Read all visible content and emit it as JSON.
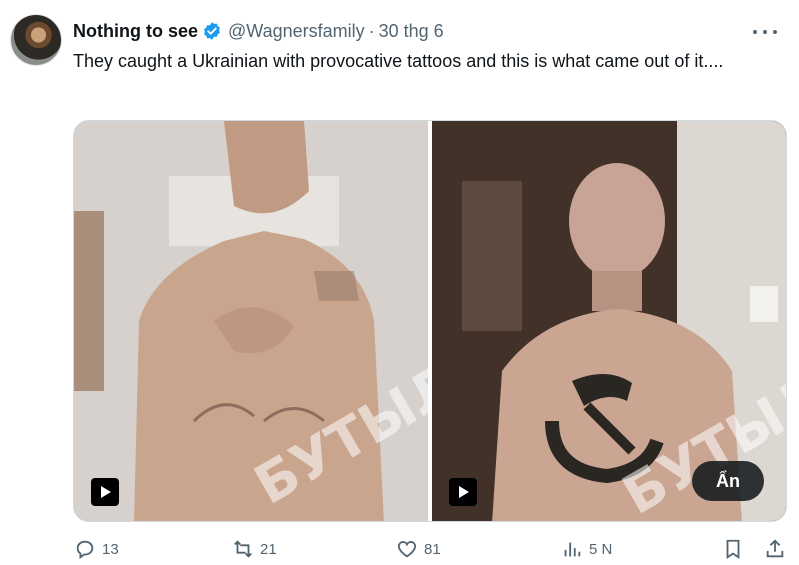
{
  "tweet": {
    "author_name": "Nothing to see",
    "handle": "@Wagnersfamily",
    "separator": "·",
    "date": "30 thg 6",
    "text": "They caught a Ukrainian with provocative tattoos and this is what came out of it...."
  },
  "media": {
    "hide_label": "Ẩn",
    "items": [
      {
        "type": "video",
        "watermark": "БУТЫЛКА"
      },
      {
        "type": "video",
        "watermark": "БУТЫЛКА"
      }
    ]
  },
  "actions": {
    "replies": "13",
    "retweets": "21",
    "likes": "81",
    "views": "5 N"
  },
  "icons": [
    "verified-badge-icon",
    "more-icon",
    "play-icon",
    "reply-icon",
    "retweet-icon",
    "like-icon",
    "views-icon",
    "bookmark-icon",
    "share-icon"
  ],
  "colors": {
    "accent": "#1d9bf0",
    "text": "#0f1419",
    "muted": "#536471"
  }
}
